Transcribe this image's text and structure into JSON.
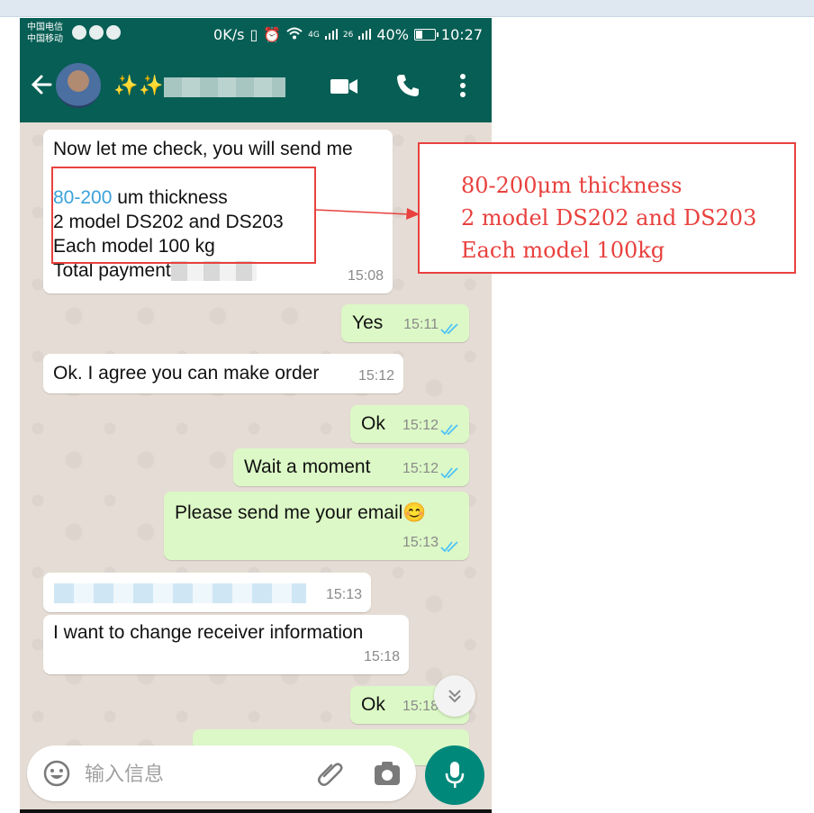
{
  "status_bar": {
    "carrier_1": "中国电信",
    "carrier_2": "中国移动",
    "net_speed": "0K/s",
    "signal_1": "4G",
    "signal_2": "26",
    "battery": "40%",
    "time": "10:27"
  },
  "header": {
    "contact_name": "✨✨"
  },
  "messages": [
    {
      "dir": "in",
      "line1": "Now let me check, you will send me",
      "link": "80-200",
      "line2_rest": " um thickness",
      "line3": "2 model DS202 and DS203",
      "line4": "Each model 100 kg",
      "line5": "Total payment",
      "time": "15:08"
    },
    {
      "dir": "out",
      "text": "Yes",
      "time": "15:11"
    },
    {
      "dir": "in",
      "text": "Ok. I agree you can make order",
      "time": "15:12"
    },
    {
      "dir": "out",
      "text": "Ok",
      "time": "15:12"
    },
    {
      "dir": "out",
      "text": "Wait a moment",
      "time": "15:12"
    },
    {
      "dir": "out",
      "text": "Please send me your email😊",
      "time": "15:13"
    },
    {
      "dir": "in",
      "text": "",
      "time": "15:13"
    },
    {
      "dir": "in",
      "text": "I want to change receiver information",
      "time": "15:18"
    },
    {
      "dir": "out",
      "text": "Ok",
      "time": "15:18"
    }
  ],
  "composer": {
    "placeholder": "输入信息"
  },
  "annotation": {
    "line1": "80-200μm thickness",
    "line2": "2 model DS202 and DS203",
    "line3": "Each model 100kg"
  },
  "colors": {
    "header": "#075e54",
    "outgoing_bubble": "#dcf8c6",
    "incoming_bubble": "#ffffff",
    "annotation_red": "#e8413e",
    "tick_blue": "#4fc3f7"
  }
}
